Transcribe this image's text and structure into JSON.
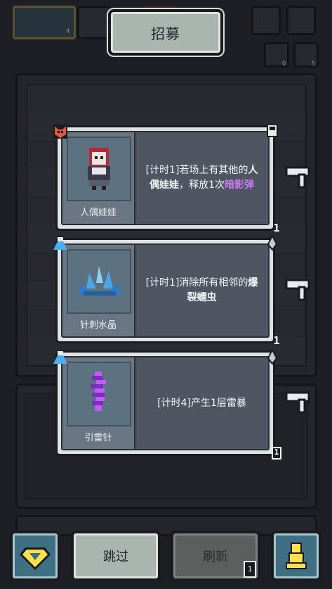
{
  "title": "招募",
  "top_bar": {
    "slot_count_left": "4",
    "icon_count_a": "0",
    "icon_count_b": "5"
  },
  "cards": [
    {
      "unit_name": "人偶娃娃",
      "desc_prefix": "[计时1]若场上有其他的",
      "desc_bold": "人偶娃娃",
      "desc_middle": "，释放1次",
      "desc_highlight": "暗影弹",
      "stock": "1",
      "tag_icon": "fox-mask-icon",
      "corner_icon": "lock-icon",
      "highlight_color": "#c57cf0"
    },
    {
      "unit_name": "针刺水晶",
      "desc_prefix": "[计时1]消除所有相邻的",
      "desc_bold": "爆裂蠕虫",
      "stock": "1",
      "tag_icon": "potion-flask-icon",
      "corner_icon": "spike-icon"
    },
    {
      "unit_name": "引雷针",
      "desc_prefix": "[计时4]产生1层雷暴",
      "stock": "1",
      "tag_icon": "potion-flask-icon",
      "corner_icon": "spike-icon"
    }
  ],
  "bottom": {
    "skip_label": "跳过",
    "refresh_label": "刷新",
    "refresh_cost": "1"
  },
  "colors": {
    "accent_teal": "#3e6f83",
    "gem_yellow": "#ffe14a",
    "panel_light": "#aab5b0"
  }
}
